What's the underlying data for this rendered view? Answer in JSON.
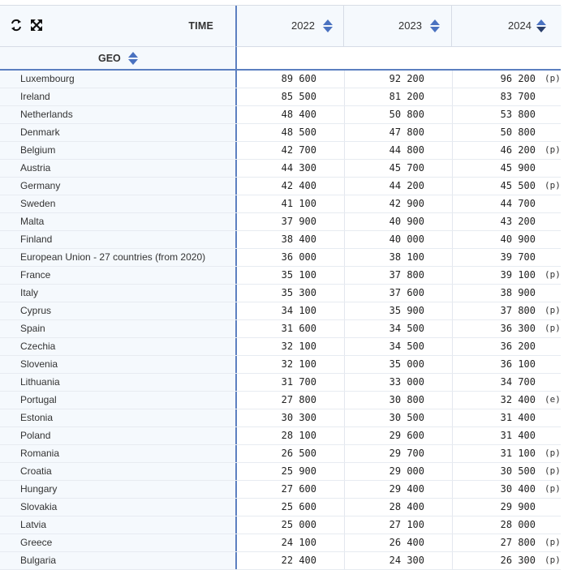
{
  "toolbar": {
    "swap_icon": "swap-arrows-icon",
    "expand_icon": "expand-arrows-icon",
    "time_label": "TIME",
    "geo_label": "GEO"
  },
  "columns": [
    {
      "label": "2022"
    },
    {
      "label": "2023"
    },
    {
      "label": "2024"
    }
  ],
  "colors": {
    "accent": "#4a72c0",
    "header_bg": "#f5f9fd",
    "divider": "#5b7fc0"
  },
  "rows": [
    {
      "geo": "Luxembourg",
      "v2022": "89 600",
      "v2023": "92 200",
      "v2024": "96 200",
      "flag": "(p)"
    },
    {
      "geo": "Ireland",
      "v2022": "85 500",
      "v2023": "81 200",
      "v2024": "83 700",
      "flag": ""
    },
    {
      "geo": "Netherlands",
      "v2022": "48 400",
      "v2023": "50 800",
      "v2024": "53 800",
      "flag": ""
    },
    {
      "geo": "Denmark",
      "v2022": "48 500",
      "v2023": "47 800",
      "v2024": "50 800",
      "flag": ""
    },
    {
      "geo": "Belgium",
      "v2022": "42 700",
      "v2023": "44 800",
      "v2024": "46 200",
      "flag": "(p)"
    },
    {
      "geo": "Austria",
      "v2022": "44 300",
      "v2023": "45 700",
      "v2024": "45 900",
      "flag": ""
    },
    {
      "geo": "Germany",
      "v2022": "42 400",
      "v2023": "44 200",
      "v2024": "45 500",
      "flag": "(p)"
    },
    {
      "geo": "Sweden",
      "v2022": "41 100",
      "v2023": "42 900",
      "v2024": "44 700",
      "flag": ""
    },
    {
      "geo": "Malta",
      "v2022": "37 900",
      "v2023": "40 900",
      "v2024": "43 200",
      "flag": ""
    },
    {
      "geo": "Finland",
      "v2022": "38 400",
      "v2023": "40 000",
      "v2024": "40 900",
      "flag": ""
    },
    {
      "geo": "European Union - 27 countries (from 2020)",
      "v2022": "36 000",
      "v2023": "38 100",
      "v2024": "39 700",
      "flag": ""
    },
    {
      "geo": "France",
      "v2022": "35 100",
      "v2023": "37 800",
      "v2024": "39 100",
      "flag": "(p)"
    },
    {
      "geo": "Italy",
      "v2022": "35 300",
      "v2023": "37 600",
      "v2024": "38 900",
      "flag": ""
    },
    {
      "geo": "Cyprus",
      "v2022": "34 100",
      "v2023": "35 900",
      "v2024": "37 800",
      "flag": "(p)"
    },
    {
      "geo": "Spain",
      "v2022": "31 600",
      "v2023": "34 500",
      "v2024": "36 300",
      "flag": "(p)"
    },
    {
      "geo": "Czechia",
      "v2022": "32 100",
      "v2023": "34 500",
      "v2024": "36 200",
      "flag": ""
    },
    {
      "geo": "Slovenia",
      "v2022": "32 100",
      "v2023": "35 000",
      "v2024": "36 100",
      "flag": ""
    },
    {
      "geo": "Lithuania",
      "v2022": "31 700",
      "v2023": "33 000",
      "v2024": "34 700",
      "flag": ""
    },
    {
      "geo": "Portugal",
      "v2022": "27 800",
      "v2023": "30 800",
      "v2024": "32 400",
      "flag": "(e)"
    },
    {
      "geo": "Estonia",
      "v2022": "30 300",
      "v2023": "30 500",
      "v2024": "31 400",
      "flag": ""
    },
    {
      "geo": "Poland",
      "v2022": "28 100",
      "v2023": "29 600",
      "v2024": "31 400",
      "flag": ""
    },
    {
      "geo": "Romania",
      "v2022": "26 500",
      "v2023": "29 700",
      "v2024": "31 100",
      "flag": "(p)"
    },
    {
      "geo": "Croatia",
      "v2022": "25 900",
      "v2023": "29 000",
      "v2024": "30 500",
      "flag": "(p)"
    },
    {
      "geo": "Hungary",
      "v2022": "27 600",
      "v2023": "29 400",
      "v2024": "30 400",
      "flag": "(p)"
    },
    {
      "geo": "Slovakia",
      "v2022": "25 600",
      "v2023": "28 400",
      "v2024": "29 900",
      "flag": ""
    },
    {
      "geo": "Latvia",
      "v2022": "25 000",
      "v2023": "27 100",
      "v2024": "28 000",
      "flag": ""
    },
    {
      "geo": "Greece",
      "v2022": "24 100",
      "v2023": "26 400",
      "v2024": "27 800",
      "flag": "(p)"
    },
    {
      "geo": "Bulgaria",
      "v2022": "22 400",
      "v2023": "24 300",
      "v2024": "26 300",
      "flag": "(p)"
    }
  ]
}
